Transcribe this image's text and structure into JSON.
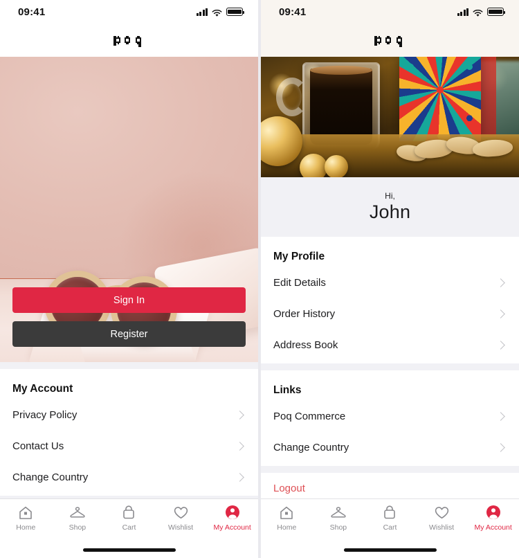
{
  "left": {
    "status": {
      "time": "09:41",
      "signal_icon": "cellular-signal-icon",
      "wifi_icon": "wifi-icon",
      "battery_icon": "battery-icon"
    },
    "brand": "poq",
    "hero": {
      "alt": "sunglasses-hero-image"
    },
    "buttons": {
      "sign_in": "Sign In",
      "register": "Register"
    },
    "account_section": {
      "title": "My Account",
      "items": [
        {
          "label": "Privacy Policy"
        },
        {
          "label": "Contact Us"
        },
        {
          "label": "Change Country"
        }
      ]
    },
    "tabs": [
      {
        "label": "Home",
        "icon": "home-icon",
        "active": false
      },
      {
        "label": "Shop",
        "icon": "hanger-icon",
        "active": false
      },
      {
        "label": "Cart",
        "icon": "bag-icon",
        "active": false
      },
      {
        "label": "Wishlist",
        "icon": "heart-icon",
        "active": false
      },
      {
        "label": "My Account",
        "icon": "account-icon",
        "active": true
      }
    ]
  },
  "right": {
    "status": {
      "time": "09:41",
      "signal_icon": "cellular-signal-icon",
      "wifi_icon": "wifi-icon",
      "battery_icon": "battery-icon"
    },
    "brand": "poq",
    "hero": {
      "alt": "festive-coffee-hero-image"
    },
    "greeting": {
      "salutation": "Hi,",
      "name": "John"
    },
    "profile_section": {
      "title": "My Profile",
      "items": [
        {
          "label": "Edit Details"
        },
        {
          "label": "Order History"
        },
        {
          "label": "Address Book"
        }
      ]
    },
    "links_section": {
      "title": "Links",
      "items": [
        {
          "label": "Poq Commerce"
        },
        {
          "label": "Change Country"
        }
      ]
    },
    "logout": {
      "label": "Logout"
    },
    "tabs": [
      {
        "label": "Home",
        "icon": "home-icon",
        "active": false
      },
      {
        "label": "Shop",
        "icon": "hanger-icon",
        "active": false
      },
      {
        "label": "Cart",
        "icon": "bag-icon",
        "active": false
      },
      {
        "label": "Wishlist",
        "icon": "heart-icon",
        "active": false
      },
      {
        "label": "My Account",
        "icon": "account-icon",
        "active": true
      }
    ]
  },
  "colors": {
    "accent_red": "#E02744",
    "logout_red": "#DE5055",
    "register_dark": "#3B3B3B",
    "section_bg": "#F1F1F5",
    "inactive_gray": "#8A8A8E"
  }
}
